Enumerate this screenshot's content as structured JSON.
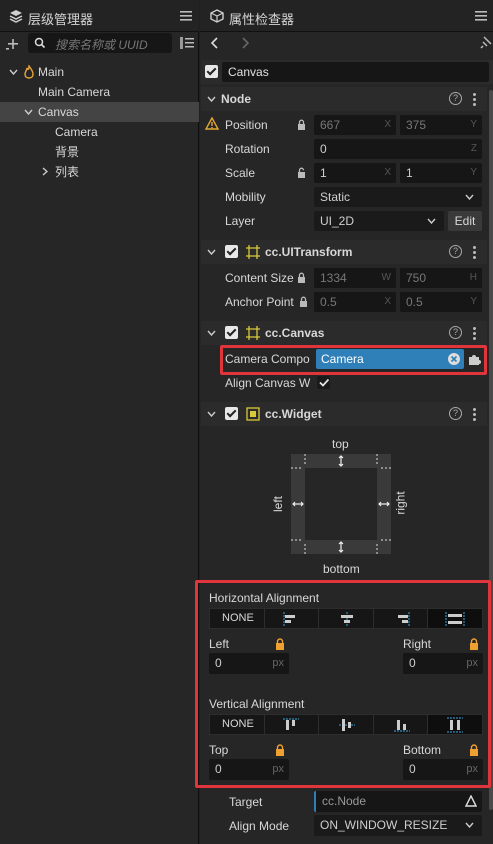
{
  "hierarchy": {
    "title": "层级管理器",
    "search_placeholder": "搜索名称或 UUID",
    "nodes": {
      "main": "Main",
      "main_camera": "Main Camera",
      "canvas": "Canvas",
      "camera": "Camera",
      "bg": "背景",
      "list": "列表"
    }
  },
  "inspector": {
    "title": "属性检查器",
    "node_name": "Canvas",
    "node": {
      "title": "Node",
      "position_label": "Position",
      "position_x": "667",
      "position_y": "375",
      "rotation_label": "Rotation",
      "rotation_z": "0",
      "scale_label": "Scale",
      "scale_x": "1",
      "scale_y": "1",
      "mobility_label": "Mobility",
      "mobility_value": "Static",
      "layer_label": "Layer",
      "layer_value": "UI_2D",
      "edit_label": "Edit"
    },
    "uitransform": {
      "title": "cc.UITransform",
      "content_size_label": "Content Size",
      "width": "1334",
      "height": "750",
      "anchor_label": "Anchor Point",
      "anchor_x": "0.5",
      "anchor_y": "0.5"
    },
    "canvas_comp": {
      "title": "cc.Canvas",
      "camera_label": "Camera Compo",
      "camera_value": "Camera",
      "align_label": "Align Canvas W"
    },
    "widget": {
      "title": "cc.Widget",
      "top": "top",
      "bottom": "bottom",
      "left": "left",
      "right": "right",
      "h_align_title": "Horizontal Alignment",
      "none": "NONE",
      "left_label": "Left",
      "right_label": "Right",
      "left_value": "0",
      "right_value": "0",
      "px": "px",
      "v_align_title": "Vertical Alignment",
      "top_label": "Top",
      "bottom_label": "Bottom",
      "top_value": "0",
      "bottom_value": "0",
      "target_label": "Target",
      "target_value": "cc.Node",
      "align_mode_label": "Align Mode",
      "align_mode_value": "ON_WINDOW_RESIZE"
    },
    "axes": {
      "x": "X",
      "y": "Y",
      "z": "Z",
      "w": "W",
      "h": "H"
    }
  },
  "colors": {
    "accent": "#2f7fb8",
    "highlight_box": "#e0353b",
    "warning": "#e4a834",
    "lock_orange": "#f0a030"
  }
}
